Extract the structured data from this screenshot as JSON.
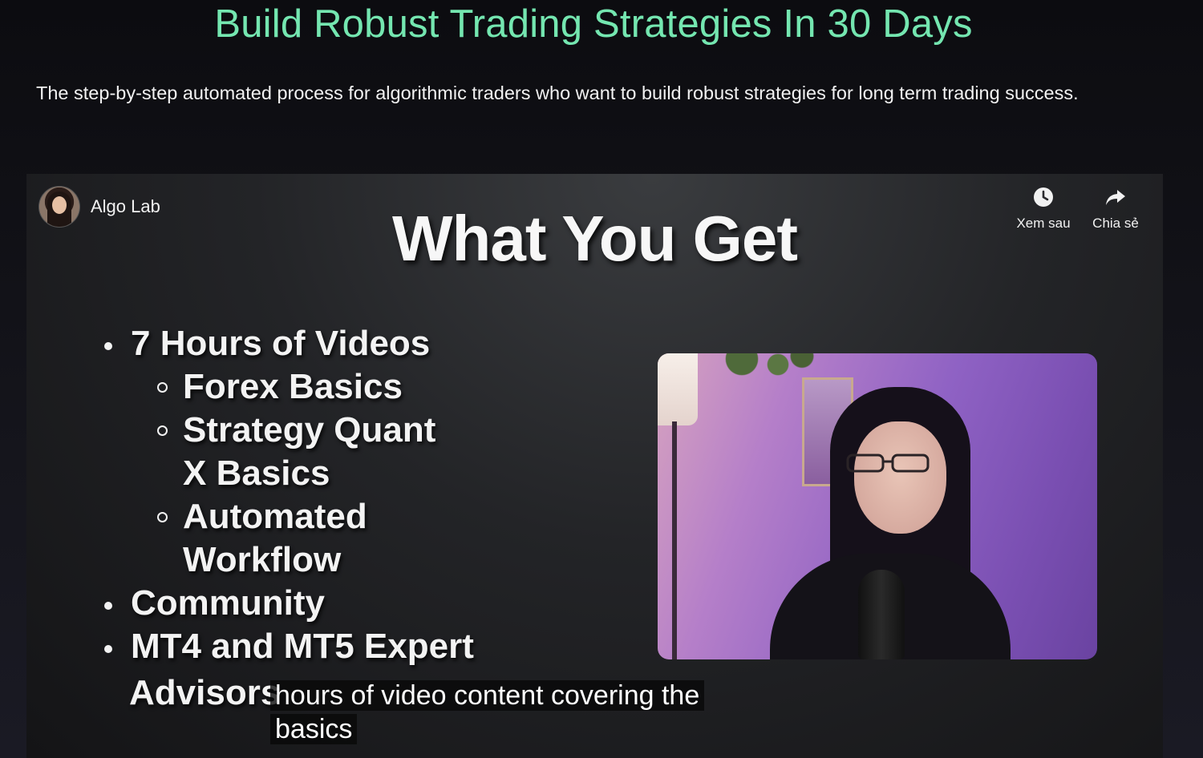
{
  "hero": {
    "title": "Build Robust Trading Strategies In 30 Days",
    "subtitle": "The step-by-step automated process for algorithmic traders who want to build robust strategies for long term trading success."
  },
  "video": {
    "channel_name": "Algo Lab",
    "actions": {
      "watch_later": {
        "label": "Xem sau",
        "icon": "clock-icon"
      },
      "share": {
        "label": "Chia sẻ",
        "icon": "share-arrow-icon"
      }
    },
    "slide": {
      "title": "What You Get",
      "items": [
        {
          "text": "7 Hours of Videos",
          "sub": [
            {
              "lines": [
                "Forex Basics"
              ]
            },
            {
              "lines": [
                "Strategy Quant",
                "X Basics"
              ]
            },
            {
              "lines": [
                "Automated",
                "Workflow"
              ]
            }
          ]
        },
        {
          "text": "Community"
        },
        {
          "text": "MT4 and MT5 Expert"
        }
      ],
      "continuation": "Advisors"
    },
    "caption": {
      "line1": "hours of video content covering the",
      "line2": "basics"
    }
  },
  "colors": {
    "accent": "#74e6b0",
    "background": "#121219"
  }
}
